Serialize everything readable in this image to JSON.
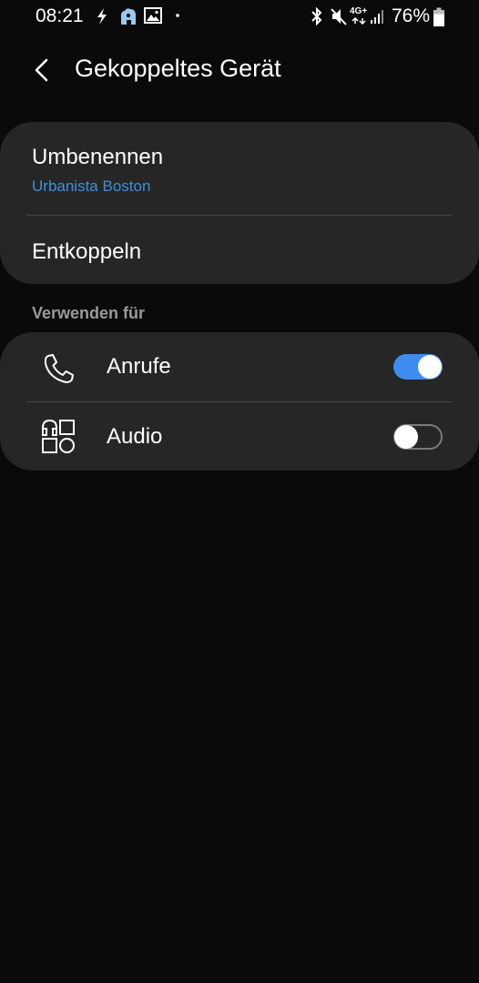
{
  "status_bar": {
    "time": "08:21",
    "battery_percent": "76%",
    "network_type": "4G+",
    "icons_left": [
      "flash-icon",
      "app-notification-icon",
      "gallery-icon",
      "more-notifications-dot-icon"
    ],
    "icons_right": [
      "bluetooth-icon",
      "mute-icon",
      "network-4g-icon",
      "signal-icon",
      "battery-icon"
    ]
  },
  "header": {
    "title": "Gekoppeltes Gerät",
    "back_icon": "back-chevron-icon"
  },
  "device_card": {
    "rename_label": "Umbenennen",
    "device_name": "Urbanista Boston",
    "unpair_label": "Entkoppeln"
  },
  "use_for": {
    "section_label": "Verwenden für",
    "options": [
      {
        "label": "Anrufe",
        "icon": "phone-icon",
        "enabled": true
      },
      {
        "label": "Audio",
        "icon": "audio-icon",
        "enabled": false
      }
    ]
  },
  "colors": {
    "background": "#0a0a0a",
    "card": "#262626",
    "accent": "#3e8cf0",
    "subtitle": "#3d8fe0",
    "section_label": "#9a9a9a"
  }
}
